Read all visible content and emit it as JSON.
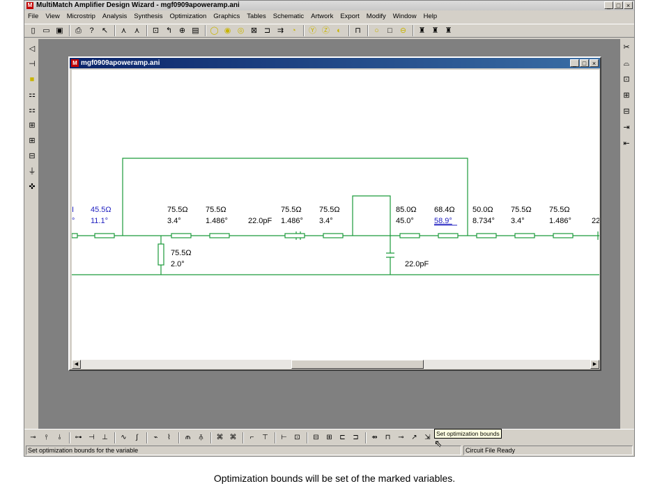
{
  "app": {
    "title": "MultiMatch Amplifier Design Wizard - mgf0909apoweramp.ani",
    "logo": "M",
    "window_buttons": [
      "_",
      "□",
      "×"
    ]
  },
  "menu": [
    "File",
    "View",
    "Microstrip",
    "Analysis",
    "Synthesis",
    "Optimization",
    "Graphics",
    "Tables",
    "Schematic",
    "Artwork",
    "Export",
    "Modify",
    "Window",
    "Help"
  ],
  "child": {
    "title": "mgf0909apoweramp.ani",
    "logo": "M",
    "window_buttons": [
      "_",
      "□",
      "×"
    ]
  },
  "schematic": {
    "wire_color": "#1a9a3a",
    "highlight_color": "#2020c0",
    "elements": [
      {
        "l1": "45.5Ω",
        "l2": "11.1°",
        "highlight": true
      },
      {
        "l1": "75.5Ω",
        "l2": "3.4°"
      },
      {
        "l1": "75.5Ω",
        "l2": "1.486°"
      },
      {
        "l1": "22.0pF",
        "l2": ""
      },
      {
        "l1": "75.5Ω",
        "l2": "1.486°"
      },
      {
        "l1": "75.5Ω",
        "l2": "3.4°"
      },
      {
        "l1": "85.0Ω",
        "l2": "45.0°"
      },
      {
        "l1": "68.4Ω",
        "l2": "58.9°",
        "highlight": true
      },
      {
        "l1": "50.0Ω",
        "l2": "8.734°"
      },
      {
        "l1": "75.5Ω",
        "l2": "3.4°"
      },
      {
        "l1": "75.5Ω",
        "l2": "1.486°"
      },
      {
        "l1": "22",
        "l2": ""
      }
    ],
    "shunt1": {
      "l1": "75.5Ω",
      "l2": "2.0°"
    },
    "shunt2": {
      "l1": "22.0pF"
    },
    "left_partial": {
      "l1": "I",
      "l2": "°"
    }
  },
  "tooltip": "Set optimization bounds",
  "status": {
    "left": "Set optimization bounds for the variable",
    "right": "Circuit File Ready"
  },
  "caption": "Optimization bounds will be set of the marked variables.",
  "icons": {
    "toolbar": [
      "new-icon",
      "open-icon",
      "save-icon",
      "print-icon",
      "help-icon",
      "context-help-icon",
      "tune-icon",
      "tune2-icon",
      "select-icon",
      "tool-a-icon",
      "tool-b-icon",
      "tool-c-icon",
      "circle-a-icon",
      "circle-b-icon",
      "circle-c-icon",
      "box-icon",
      "tool-d-icon",
      "tool-e-icon",
      "tool-f-icon",
      "smith-y-icon",
      "smith-z-icon",
      "smith-c-icon",
      "lambda-icon",
      "circle-d-icon",
      "square-icon",
      "circle-e-icon",
      "tool-g-icon",
      "tool-h-icon",
      "tool-i-icon"
    ]
  }
}
